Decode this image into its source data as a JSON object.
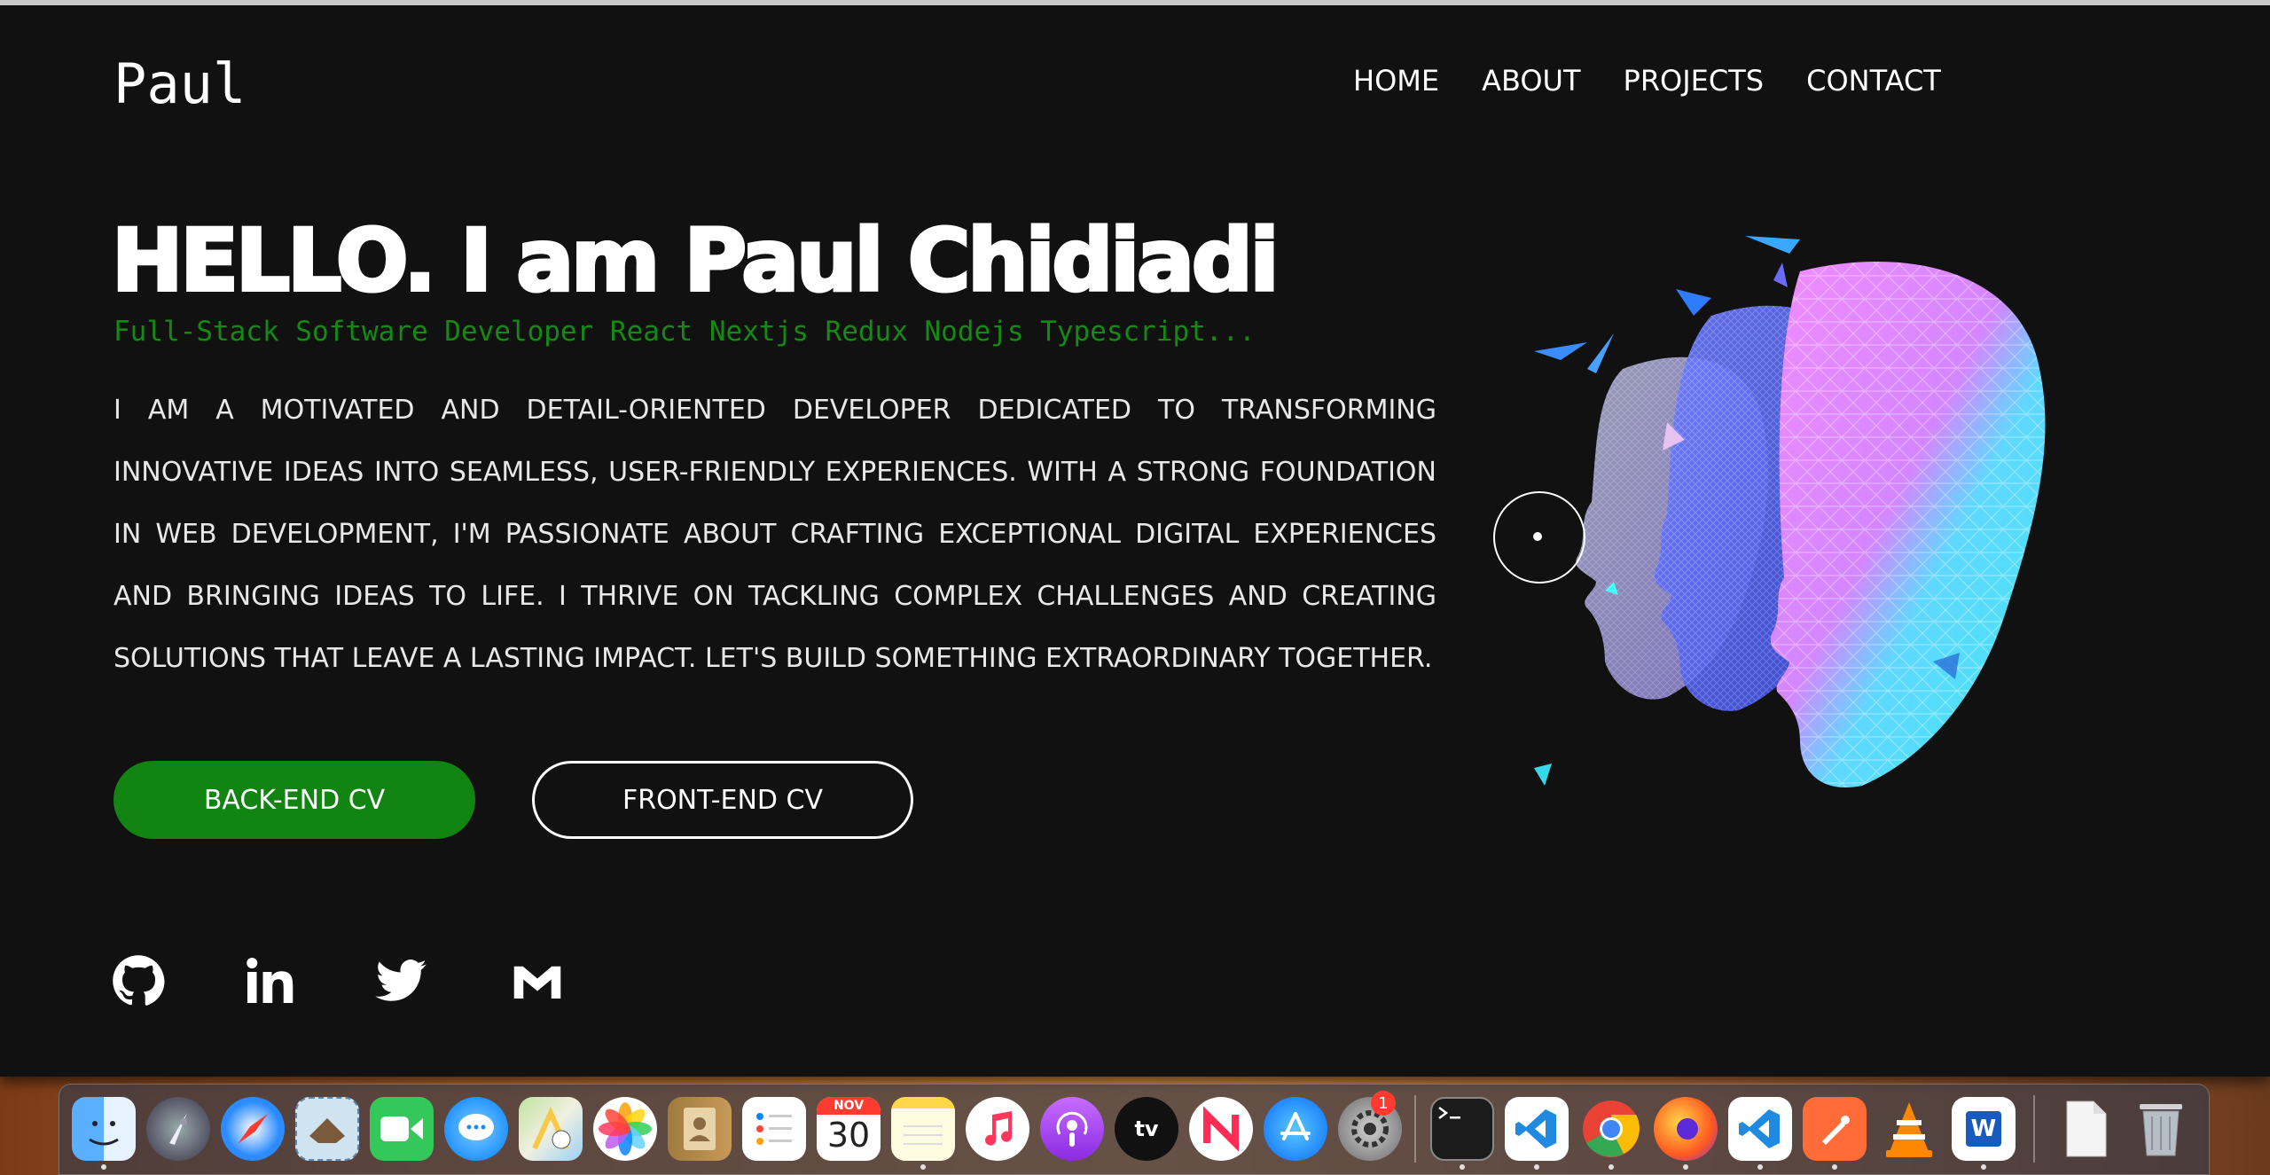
{
  "site": {
    "logo": "Paul",
    "nav": [
      "HOME",
      "ABOUT",
      "PROJECTS",
      "CONTACT"
    ]
  },
  "hero": {
    "title": "HELLO. I am Paul Chidiadi",
    "subtitle": "Full-Stack Software Developer React Nextjs Redux Nodejs Typescript...",
    "bio": "I am a motivated and detail-oriented developer dedicated to transforming innovative ideas into seamless, user-friendly experiences. With a strong foundation in web development, I'm passionate about crafting exceptional digital experiences and bringing ideas to life. I thrive on tackling complex challenges and creating solutions that leave a lasting impact. Let's build something extraordinary together.",
    "buttons": {
      "backend": "BACK-END CV",
      "frontend": "FRONT-END CV"
    }
  },
  "socials": [
    "github-icon",
    "linkedin-icon",
    "twitter-icon",
    "gmail-icon"
  ],
  "colors": {
    "accent": "#118411",
    "subtitle": "#148a14",
    "background": "#111111"
  },
  "dock": {
    "apps": [
      "Finder",
      "Launchpad",
      "Safari",
      "Mail",
      "FaceTime",
      "Messages",
      "Maps",
      "Photos",
      "Contacts",
      "Reminders",
      "Calendar",
      "Notes",
      "Music",
      "Podcasts",
      "TV",
      "News",
      "App Store",
      "System Preferences",
      "Terminal",
      "Visual Studio Code",
      "Google Chrome",
      "Firefox",
      "Visual Studio Code",
      "Postman",
      "VLC",
      "Microsoft Word",
      "Documents",
      "Trash"
    ],
    "calendar": {
      "month": "NOV",
      "day": "30"
    },
    "tv_label": "tv",
    "word_label": "W",
    "badge": "1"
  }
}
